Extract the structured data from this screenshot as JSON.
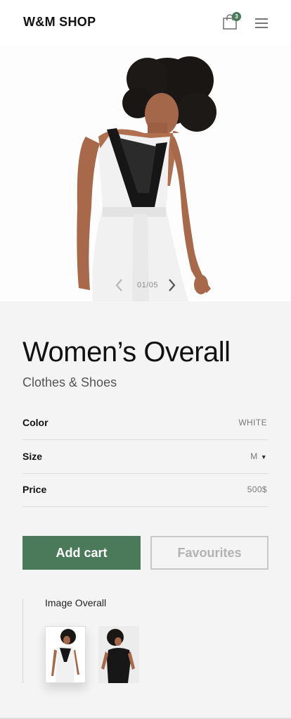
{
  "header": {
    "brand": "W&M SHOP",
    "cart_count": "3",
    "cart_icon": "shopping-bag-icon",
    "menu_icon": "hamburger-menu-icon"
  },
  "hero": {
    "slide_counter": "01/05",
    "prev_icon": "chevron-left-icon",
    "next_icon": "chevron-right-icon"
  },
  "product": {
    "title": "Women’s Overall",
    "category": "Clothes & Shoes",
    "attributes": [
      {
        "label": "Color",
        "value": "WHITE"
      },
      {
        "label": "Size",
        "value": "M"
      },
      {
        "label": "Price",
        "value": "500$"
      }
    ]
  },
  "actions": {
    "add_cart": "Add cart",
    "favourites": "Favourites"
  },
  "gallery": {
    "title": "Image Overall"
  },
  "colors": {
    "accent": "#4a7a59",
    "background": "#f4f4f4",
    "text": "#111111",
    "muted": "#777777"
  }
}
